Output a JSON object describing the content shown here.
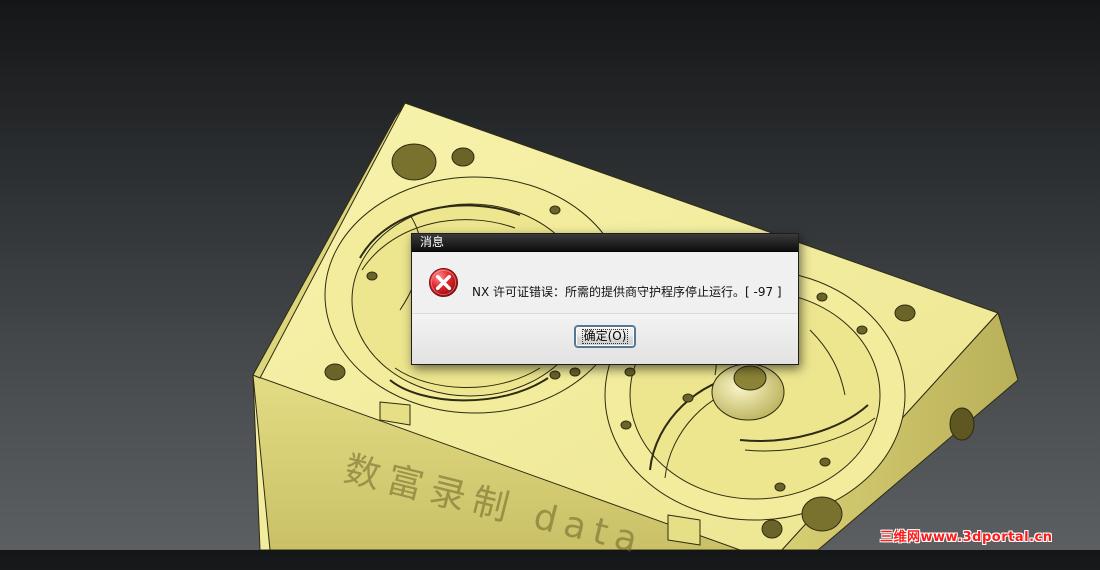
{
  "dialog": {
    "title": "消息",
    "message": "NX 许可证错误：所需的提供商守护程序停止运行。[ -97 ]",
    "ok_button_label": "确定(O)",
    "icon": "error-icon"
  },
  "viewport": {
    "engraved_text": "数富录制 data",
    "part_color": "#f3ee9e",
    "background_color": "#3a3d40"
  },
  "watermark": {
    "text": "三维网www.3dportal.cn",
    "color": "#ff1a1a"
  }
}
